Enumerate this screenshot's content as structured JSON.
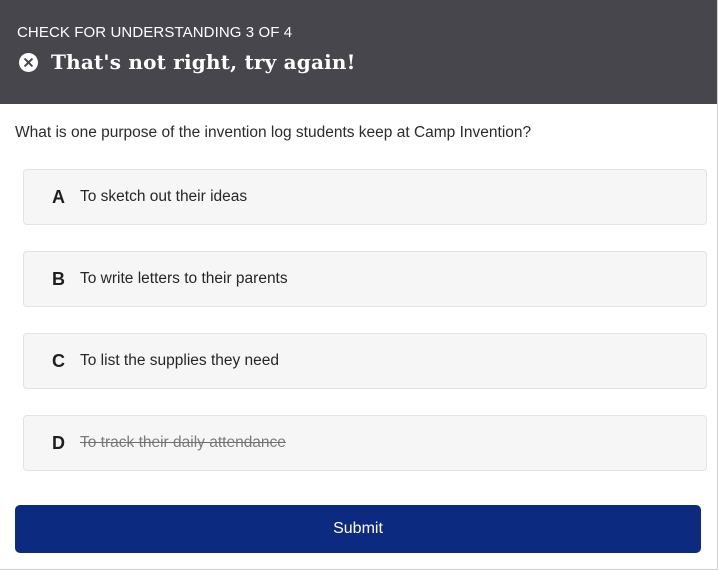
{
  "header": {
    "progress_label": "CHECK FOR UNDERSTANDING 3 OF 4",
    "feedback_text": "That's not right, try again!",
    "feedback_icon": "x-circle-icon"
  },
  "question": {
    "text": "What is one purpose of the invention log students keep at Camp Invention?"
  },
  "options": [
    {
      "letter": "A",
      "label": "To sketch out their ideas",
      "eliminated": false
    },
    {
      "letter": "B",
      "label": "To write letters to their parents",
      "eliminated": false
    },
    {
      "letter": "C",
      "label": "To list the supplies they need",
      "eliminated": false
    },
    {
      "letter": "D",
      "label": "To track their daily attendance",
      "eliminated": true
    }
  ],
  "submit": {
    "label": "Submit"
  },
  "colors": {
    "header_bg": "#47464d",
    "submit_bg": "#0b2a80",
    "option_bg": "#f6f6f6"
  }
}
